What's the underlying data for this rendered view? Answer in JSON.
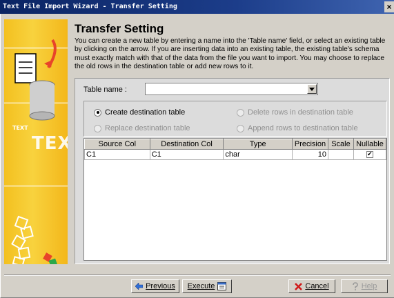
{
  "window": {
    "title": "Text File Import Wizard - Transfer Setting",
    "close_label": "×"
  },
  "art": {
    "text_small": "TEXT",
    "text_big": "TEXT"
  },
  "page": {
    "heading": "Transfer Setting",
    "description": "You can create a new table by entering a name into the 'Table name' field, or select an existing table by clicking on the arrow. If you are inserting data into an existing table, the existing table's schema must exactly match with that of the data from the file you want to import. You may choose to replace the old rows in the destination table or add new rows to it."
  },
  "table_name": {
    "label": "Table name :",
    "value": ""
  },
  "options": [
    {
      "label": "Create destination table",
      "selected": true,
      "enabled": true
    },
    {
      "label": "Delete rows in destination table",
      "selected": false,
      "enabled": false
    },
    {
      "label": "Replace destination table",
      "selected": false,
      "enabled": false
    },
    {
      "label": "Append rows to destination table",
      "selected": false,
      "enabled": false
    }
  ],
  "grid": {
    "columns": [
      "Source Col",
      "Destination Col",
      "Type",
      "Precision",
      "Scale",
      "Nullable"
    ],
    "rows": [
      {
        "source": "C1",
        "destination": "C1",
        "type": "char",
        "precision": "10",
        "scale": "",
        "nullable": true
      }
    ]
  },
  "buttons": {
    "previous": "Previous",
    "execute": "Execute",
    "cancel": "Cancel",
    "help": "Help"
  }
}
